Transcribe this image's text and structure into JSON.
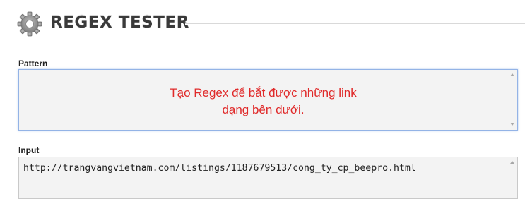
{
  "app": {
    "title": "REGEX TESTER",
    "icon": "gear-icon"
  },
  "pattern": {
    "label": "Pattern",
    "value": "Tạo Regex để bắt được những link\ndạng bên dưới."
  },
  "input": {
    "label": "Input",
    "value": "http://trangvangvietnam.com/listings/1187679513/cong_ty_cp_beepro.html"
  },
  "colors": {
    "title": "#3a3a3a",
    "pattern_text": "#e02a2a",
    "field_background": "#f3f3f3",
    "focus_border": "#93b3e6"
  }
}
